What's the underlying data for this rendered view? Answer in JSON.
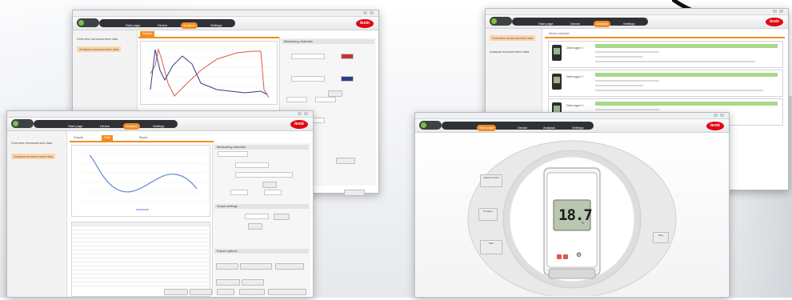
{
  "window_title": "testo Comfort Software",
  "brand": "testo",
  "nav_tabs": [
    "Start page",
    "Device",
    "Analysis",
    "Settings"
  ],
  "active_tab": "Analysis",
  "left_panel": [
    "Overview measurement data",
    "Analysis measurement data"
  ],
  "analysis_tabs": [
    "Graphic",
    "Table",
    "Report"
  ],
  "side_panel_titles": [
    "Measuring channels",
    "Graph settings",
    "Export options"
  ],
  "device_panel_titles": [
    "Device overview",
    "Data logger 1",
    "Data logger 2",
    "Data logger 3"
  ],
  "device_buttons": [
    "Read out data",
    "Program",
    "Start",
    "Stop"
  ],
  "logger_display": {
    "value": "18.7",
    "unit": "°C"
  },
  "colors": {
    "accent": "#f28c22",
    "brand_red": "#e30613",
    "series_red": "#e0564f",
    "series_blue": "#2c3e86",
    "series_line": "#5e86d6",
    "status_green": "#a8d78a"
  },
  "icons": [
    "window-minimize-icon",
    "window-close-icon",
    "chevron-down-icon"
  ]
}
